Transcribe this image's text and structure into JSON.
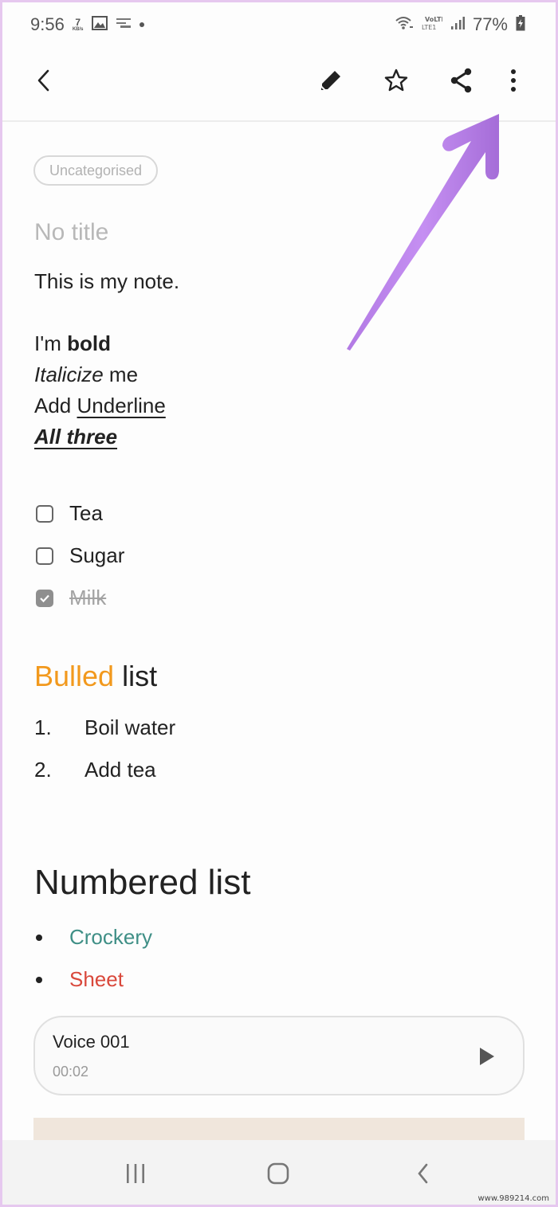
{
  "status_bar": {
    "time": "9:56",
    "net_speed_value": "7",
    "net_speed_unit": "KB/s",
    "battery_percent": "77%",
    "network_label": "LTE1",
    "volte_label": "VoLTE"
  },
  "app_bar": {
    "icons": [
      "back-icon",
      "edit-icon",
      "favorite-star-icon",
      "share-icon",
      "more-options-icon"
    ]
  },
  "note": {
    "category": "Uncategorised",
    "title_placeholder": "No title",
    "lines": {
      "intro": "This is my note.",
      "bold_prefix": "I'm ",
      "bold_word": "bold",
      "italic_word": "Italicize",
      "italic_suffix": " me",
      "underline_prefix": "Add ",
      "underline_word": "Underline ",
      "all_three": "All three "
    },
    "checklist": [
      {
        "label": "Tea",
        "checked": false
      },
      {
        "label": "Sugar",
        "checked": false
      },
      {
        "label": "Milk",
        "checked": true
      }
    ],
    "bulled_heading": {
      "colored_word": "Bulled",
      "rest": " list",
      "accent_color": "#f2991d"
    },
    "ordered_list": [
      {
        "num": "1.",
        "text": "Boil water"
      },
      {
        "num": "2.",
        "text": "Add tea"
      }
    ],
    "numbered_heading": "Numbered list",
    "bullet_list": [
      {
        "text": "Crockery",
        "color": "#3f8f86"
      },
      {
        "text": "Sheet",
        "color": "#d9483b"
      }
    ],
    "voice_attachment": {
      "name": "Voice 001",
      "duration": "00:02"
    }
  },
  "annotation": {
    "arrow_color": "#b57ee6",
    "points_to": "more-options-icon"
  },
  "nav_bar": {
    "buttons": [
      "recent-apps",
      "home",
      "back"
    ]
  },
  "watermark": "www.989214.com"
}
